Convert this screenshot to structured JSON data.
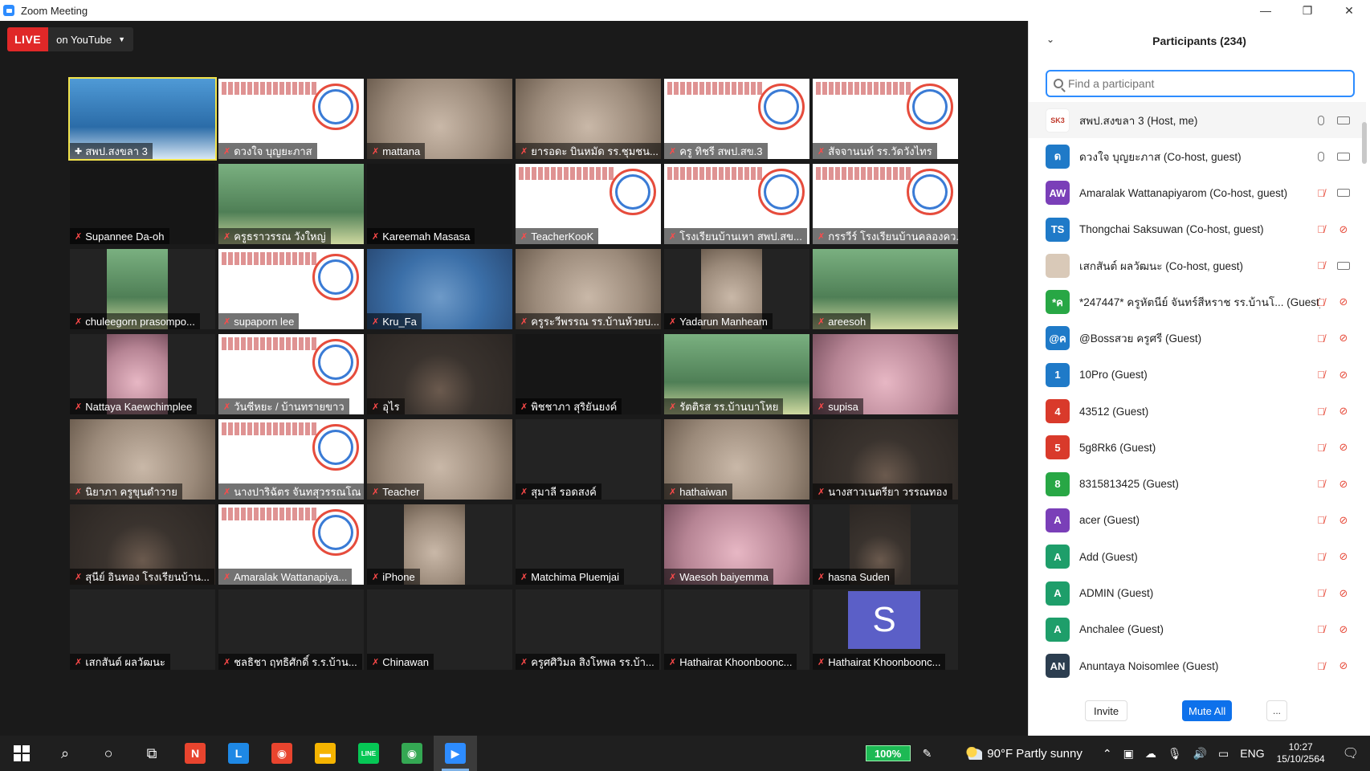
{
  "window": {
    "title": "Zoom Meeting",
    "controls": [
      "—",
      "❐",
      "✕"
    ]
  },
  "live": {
    "badge": "LIVE",
    "destination": "on YouTube"
  },
  "gallery": [
    {
      "name": "สพป.สงขลา 3",
      "type": "room",
      "active": true,
      "pinned": true
    },
    {
      "name": "ดวงใจ บุญยะภาส",
      "type": "slide"
    },
    {
      "name": "mattana",
      "type": "light"
    },
    {
      "name": "ยารอดะ บินหมัด รร.ชุมชน...",
      "type": "light"
    },
    {
      "name": "ครู ทิชรี สพป.สข.3",
      "type": "slide"
    },
    {
      "name": "สัจจานนท์ รร.วัดวังไทร",
      "type": "slide"
    },
    {
      "name": "Supannee Da-oh",
      "type": "dark"
    },
    {
      "name": "ครูธราวรรณ วังใหญ่",
      "type": "green"
    },
    {
      "name": "Kareemah Masasa",
      "type": "dark"
    },
    {
      "name": "TeacherKooK",
      "type": "slide"
    },
    {
      "name": "โรงเรียนบ้านเหา สพป.สข...",
      "type": "slide"
    },
    {
      "name": "กรรวีร์ โรงเรียนบ้านคลองคว...",
      "type": "slide"
    },
    {
      "name": "chuleegorn prasompo...",
      "type": "green",
      "narrow": true
    },
    {
      "name": "supaporn lee",
      "type": "slide"
    },
    {
      "name": "Kru_Fa",
      "type": "blue"
    },
    {
      "name": "ครูระวีพรรณ รร.บ้านห้วยบ...",
      "type": "light"
    },
    {
      "name": "Yadarun Manheam",
      "type": "light",
      "narrow": true
    },
    {
      "name": "areesoh",
      "type": "green"
    },
    {
      "name": "Nattaya Kaewchimplee",
      "type": "pink",
      "narrow": true
    },
    {
      "name": "วันซีหยะ / บ้านทรายขาว",
      "type": "slide"
    },
    {
      "name": "อุไร",
      "type": "cam"
    },
    {
      "name": "พิชชาภา สุริยันยงค์",
      "type": "dark"
    },
    {
      "name": "รัตติรส รร.บ้านบาโหย",
      "type": "green"
    },
    {
      "name": "supisa",
      "type": "pink"
    },
    {
      "name": "นิยาภา ครูขุนดำวาย",
      "type": "light"
    },
    {
      "name": "นางปาริฉัตร จันทสุวรรณโณ",
      "type": "slide"
    },
    {
      "name": "Teacher",
      "type": "light"
    },
    {
      "name": "สุมาลี รอดสงค์",
      "type": "none"
    },
    {
      "name": "hathaiwan",
      "type": "light"
    },
    {
      "name": "นางสาวเนตรียา วรรณทอง",
      "type": "cam"
    },
    {
      "name": "สุนีย์ อินทอง โรงเรียนบ้าน...",
      "type": "cam"
    },
    {
      "name": "Amaralak Wattanapiya...",
      "type": "slide"
    },
    {
      "name": "iPhone",
      "type": "light",
      "narrow": true
    },
    {
      "name": "Matchima Pluemjai",
      "type": "none"
    },
    {
      "name": "Waesoh baiyemma",
      "type": "pink"
    },
    {
      "name": "hasna Suden",
      "type": "cam",
      "narrow": true
    },
    {
      "name": "เสกสันต์ ผลวัฒนะ",
      "type": "none"
    },
    {
      "name": "ชลธิชา ฤทธิศักดิ์ ร.ร.บ้าน...",
      "type": "none"
    },
    {
      "name": "Chinawan",
      "type": "none"
    },
    {
      "name": "ครูศศิวิมล สิงโหพล รร.บ้า...",
      "type": "none"
    },
    {
      "name": "Hathairat Khoonboonc...",
      "type": "none"
    },
    {
      "name": "Hathairat Khoonboonc...",
      "type": "avatar",
      "avatar": "S"
    }
  ],
  "participants": {
    "title": "Participants (234)",
    "search_placeholder": "Find a participant",
    "list": [
      {
        "initials": "SK3",
        "color": "#ffffff",
        "name": "สพป.สงขลา 3 (Host, me)",
        "mic": "on",
        "cam": "on",
        "logo": true
      },
      {
        "initials": "ด",
        "color": "#1f7ac8",
        "name": "ดวงใจ บุญยะภาส (Co-host, guest)",
        "mic": "on",
        "cam": "on"
      },
      {
        "initials": "AW",
        "color": "#7a3fb8",
        "name": "Amaralak Wattanapiyarom (Co-host, guest)",
        "mic": "off",
        "cam": "on"
      },
      {
        "initials": "TS",
        "color": "#1f7ac8",
        "name": "Thongchai Saksuwan (Co-host, guest)",
        "mic": "off",
        "cam": "off"
      },
      {
        "initials": "",
        "color": "#d9c9b8",
        "name": "เสกสันต์ ผลวัฒนะ (Co-host, guest)",
        "mic": "off",
        "cam": "on"
      },
      {
        "initials": "*ค",
        "color": "#28a745",
        "name": "*247447* ครูหัตนีย์ จันทร์สีหราช รร.บ้านโ...  (Guest)",
        "mic": "off",
        "cam": "off"
      },
      {
        "initials": "@ค",
        "color": "#1f7ac8",
        "name": "@Bossสวย ครูศรี (Guest)",
        "mic": "off",
        "cam": "off"
      },
      {
        "initials": "1",
        "color": "#1f7ac8",
        "name": "10Pro (Guest)",
        "mic": "off",
        "cam": "off"
      },
      {
        "initials": "4",
        "color": "#d93a2b",
        "name": "43512 (Guest)",
        "mic": "off",
        "cam": "off"
      },
      {
        "initials": "5",
        "color": "#d93a2b",
        "name": "5g8Rk6 (Guest)",
        "mic": "off",
        "cam": "off"
      },
      {
        "initials": "8",
        "color": "#28a745",
        "name": "8315813425 (Guest)",
        "mic": "off",
        "cam": "off"
      },
      {
        "initials": "A",
        "color": "#7a3fb8",
        "name": "acer (Guest)",
        "mic": "off",
        "cam": "off"
      },
      {
        "initials": "A",
        "color": "#1e9e6a",
        "name": "Add (Guest)",
        "mic": "off",
        "cam": "off"
      },
      {
        "initials": "A",
        "color": "#1e9e6a",
        "name": "ADMIN (Guest)",
        "mic": "off",
        "cam": "off"
      },
      {
        "initials": "A",
        "color": "#1e9e6a",
        "name": "Anchalee (Guest)",
        "mic": "off",
        "cam": "off"
      },
      {
        "initials": "AN",
        "color": "#2c3e50",
        "name": "Anuntaya Noisomlee (Guest)",
        "mic": "off",
        "cam": "off"
      }
    ],
    "invite_label": "Invite",
    "mute_all_label": "Mute All",
    "more_label": "..."
  },
  "taskbar": {
    "battery": "100%",
    "weather": "90°F  Partly sunny",
    "language": "ENG",
    "time": "10:27",
    "date": "15/10/2564",
    "apps": [
      {
        "name": "start-button",
        "label": ""
      },
      {
        "name": "search-icon",
        "label": "⌕"
      },
      {
        "name": "cortana-icon",
        "label": "○"
      },
      {
        "name": "task-view-icon",
        "label": "⧉"
      },
      {
        "name": "red-app-icon",
        "label": "N",
        "color": "#e8442e"
      },
      {
        "name": "l-app-icon",
        "label": "L",
        "color": "#1e88e5"
      },
      {
        "name": "chrome-icon",
        "label": "◉",
        "color": "#e8442e"
      },
      {
        "name": "file-explorer-icon",
        "label": "▬",
        "color": "#f5b400"
      },
      {
        "name": "line-app-icon",
        "label": "LINE",
        "color": "#06c755"
      },
      {
        "name": "chrome-2-icon",
        "label": "◉",
        "color": "#34a853"
      },
      {
        "name": "zoom-app-icon",
        "label": "▶",
        "color": "#2d8cff"
      }
    ]
  }
}
